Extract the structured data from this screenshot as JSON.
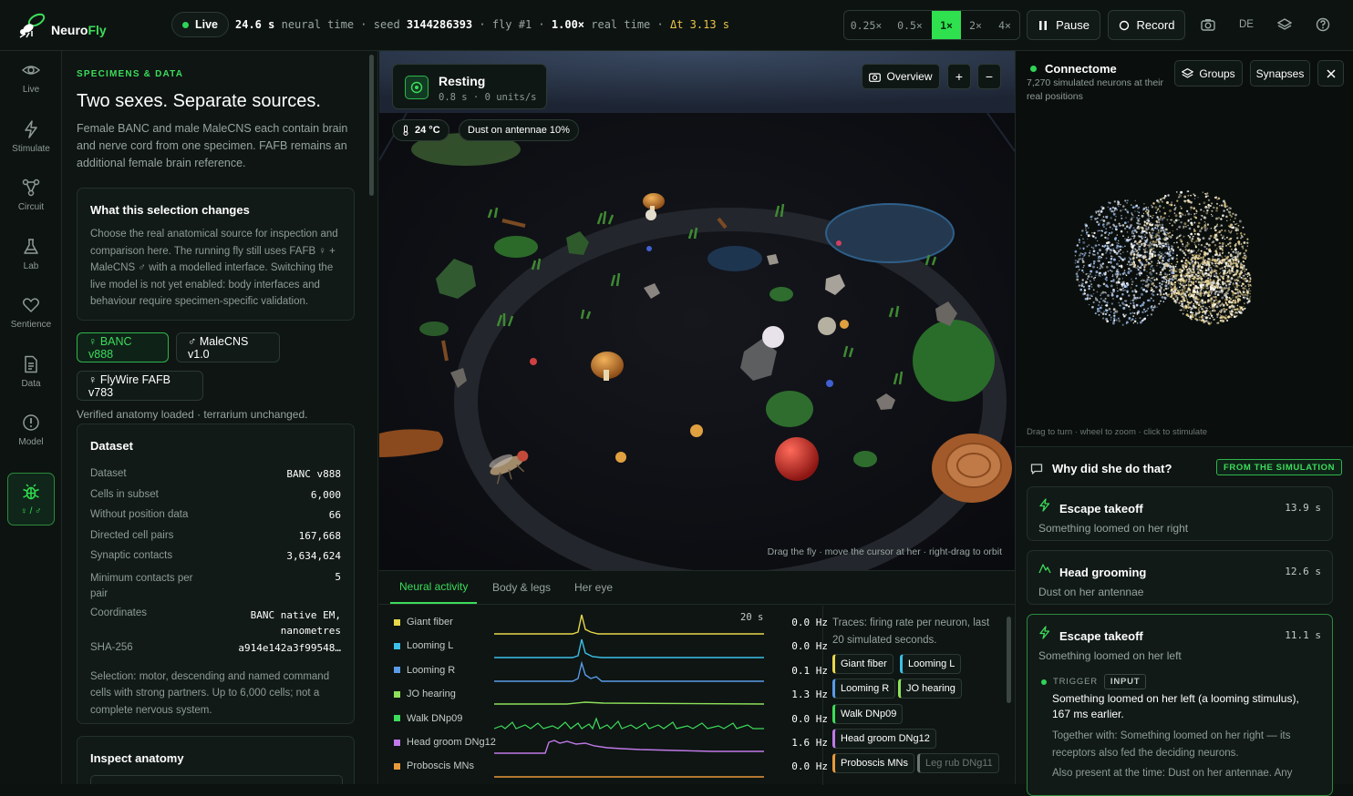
{
  "app": {
    "name_part1": "Neuro",
    "name_part2": "Fly"
  },
  "topbar": {
    "live_label": "Live",
    "neural_time": "24.6 s",
    "neural_time_label": "neural time",
    "seed_label": "seed",
    "seed": "3144286393",
    "fly_label": "fly #1",
    "real_rate": "1.00×",
    "real_time_label": "real time",
    "dt": "Δt 3.13 s",
    "speeds": [
      "0.25×",
      "0.5×",
      "1×",
      "2×",
      "4×"
    ],
    "active_speed": "1×",
    "pause_label": "Pause",
    "record_label": "Record",
    "lang_label": "DE"
  },
  "rail": {
    "items": [
      {
        "label": "Live",
        "icon": "eye-icon"
      },
      {
        "label": "Stimulate",
        "icon": "bolt-icon"
      },
      {
        "label": "Circuit",
        "icon": "circuit-icon"
      },
      {
        "label": "Lab",
        "icon": "flask-icon"
      },
      {
        "label": "Sentience",
        "icon": "heart-icon"
      },
      {
        "label": "Data",
        "icon": "document-icon"
      },
      {
        "label": "Model",
        "icon": "alert-circle-icon"
      },
      {
        "label": "♀ / ♂",
        "icon": "bug-icon"
      }
    ]
  },
  "left": {
    "eyebrow": "SPECIMENS & DATA",
    "title": "Two sexes. Separate sources.",
    "description": "Female BANC and male MaleCNS each contain brain and nerve cord from one specimen. FAFB remains an additional female brain reference.",
    "selection_card": {
      "title": "What this selection changes",
      "body": "Choose the real anatomical source for inspection and comparison here. The running fly still uses FAFB ♀ + MaleCNS ♂ with a modelled interface. Switching the live model is not yet enabled: body interfaces and behaviour require specimen-specific validation."
    },
    "sources": [
      "♀ BANC v888",
      "♂ MaleCNS v1.0",
      "♀ FlyWire FAFB v783"
    ],
    "verified": "Verified anatomy loaded · terrarium unchanged.",
    "dataset": {
      "title": "Dataset",
      "rows": [
        {
          "k": "Dataset",
          "v": "BANC v888"
        },
        {
          "k": "Cells in subset",
          "v": "6,000"
        },
        {
          "k": "Without position data",
          "v": "66"
        },
        {
          "k": "Directed cell pairs",
          "v": "167,668"
        },
        {
          "k": "Synaptic contacts",
          "v": "3,634,624"
        },
        {
          "k": "Minimum contacts per pair",
          "v": "5"
        },
        {
          "k": "Coordinates",
          "v": "BANC native EM, nanometres"
        },
        {
          "k": "SHA-256",
          "v": "a914e142a3f99548…"
        }
      ],
      "selection_note": "Selection: motor, descending and named command cells with strong partners. Up to 6,000 cells; not a complete nervous system."
    },
    "inspect_title": "Inspect anatomy"
  },
  "viewport": {
    "state_title": "Resting",
    "state_sub": "0.8 s · 0 units/s",
    "temperature": "24 °C",
    "stimulus": "Dust on antennae 10%",
    "overview_label": "Overview",
    "zoom_in": "+",
    "zoom_out": "−",
    "hint": "Drag the fly · move the cursor at her · right-drag to orbit"
  },
  "bottom": {
    "tabs": [
      "Neural activity",
      "Body & legs",
      "Her eye"
    ],
    "window_label": "20 s",
    "traces": [
      {
        "name": "Giant fiber",
        "hz": "0.0 Hz",
        "color": "#e8d84a"
      },
      {
        "name": "Looming L",
        "hz": "0.0 Hz",
        "color": "#3cc0e8"
      },
      {
        "name": "Looming R",
        "hz": "0.1 Hz",
        "color": "#5a9be8"
      },
      {
        "name": "JO hearing",
        "hz": "1.3 Hz",
        "color": "#8ee05a"
      },
      {
        "name": "Walk DNp09",
        "hz": "0.0 Hz",
        "color": "#3ddc5a"
      },
      {
        "name": "Head groom DNg12",
        "hz": "1.6 Hz",
        "color": "#c07ae8"
      },
      {
        "name": "Proboscis MNs",
        "hz": "0.0 Hz",
        "color": "#e89a3a"
      }
    ],
    "note": "Traces: firing rate per neuron, last 20 simulated seconds.",
    "tags": [
      {
        "label": "Giant fiber",
        "color": "#e8d84a"
      },
      {
        "label": "Looming L",
        "color": "#3cc0e8"
      },
      {
        "label": "Looming R",
        "color": "#5a9be8"
      },
      {
        "label": "JO hearing",
        "color": "#8ee05a"
      },
      {
        "label": "Walk DNp09",
        "color": "#3ddc5a"
      },
      {
        "label": "Head groom DNg12",
        "color": "#c07ae8"
      },
      {
        "label": "Proboscis MNs",
        "color": "#e89a3a"
      },
      {
        "label": "Leg rub DNg11",
        "color": "#6c7773"
      }
    ]
  },
  "right": {
    "conn_title": "Connectome",
    "conn_sub": "7,270 simulated neurons at their real positions",
    "groups_label": "Groups",
    "synapses_label": "Synapses",
    "hint": "Drag to turn · wheel to zoom · click to stimulate",
    "why_title": "Why did she do that?",
    "why_badge": "FROM THE SIMULATION",
    "events": [
      {
        "title": "Escape takeoff",
        "time": "13.9 s",
        "desc": "Something loomed on her right"
      },
      {
        "title": "Head grooming",
        "time": "12.6 s",
        "desc": "Dust on her antennae"
      },
      {
        "title": "Escape takeoff",
        "time": "11.1 s",
        "desc": "Something loomed on her left"
      }
    ],
    "trigger_label": "TRIGGER",
    "trigger_badge": "INPUT",
    "trigger_text": "Something loomed on her left (a looming stimulus), 167 ms earlier.",
    "trigger_together": "Together with: Something loomed on her right — its receptors also fed the deciding neurons.",
    "trigger_present": "Also present at the time: Dust on her antennae. Any"
  }
}
